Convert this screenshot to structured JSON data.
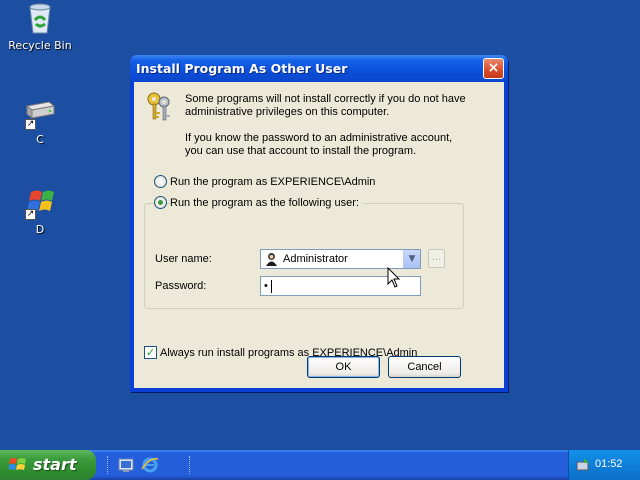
{
  "desktop": {
    "icons": [
      {
        "label": "Recycle Bin",
        "icon": "recycle-bin-icon"
      },
      {
        "label": "C",
        "icon": "drive-icon"
      },
      {
        "label": "D",
        "icon": "windows-cd-icon"
      }
    ]
  },
  "dialog": {
    "title": "Install Program As Other User",
    "close_icon": "×",
    "intro_line1": "Some programs will not install correctly if you do not have",
    "intro_line2": "administrative privileges on this computer.",
    "intro_line3": "If you know the password to an administrative account,",
    "intro_line4": "you can use that account to install the program.",
    "radio_current": "Run the program as EXPERIENCE\\Admin",
    "radio_following": "Run the program as the following user:",
    "radio_selected": "following",
    "user_name_label": "User name:",
    "user_name_value": "Administrator",
    "browse_label": "...",
    "password_label": "Password:",
    "password_value": "•",
    "always_run_label": "Always run install programs as EXPERIENCE\\Admin",
    "always_run_checked": true,
    "ok_label": "OK",
    "cancel_label": "Cancel"
  },
  "taskbar": {
    "start_label": "start",
    "clock": "01:52"
  },
  "colors": {
    "desktop": "#1c4ea2",
    "titlebar": "#0a46cc",
    "dialog_face": "#ece9d8",
    "start_green": "#3c9b3c",
    "taskbar_blue": "#245edb"
  }
}
